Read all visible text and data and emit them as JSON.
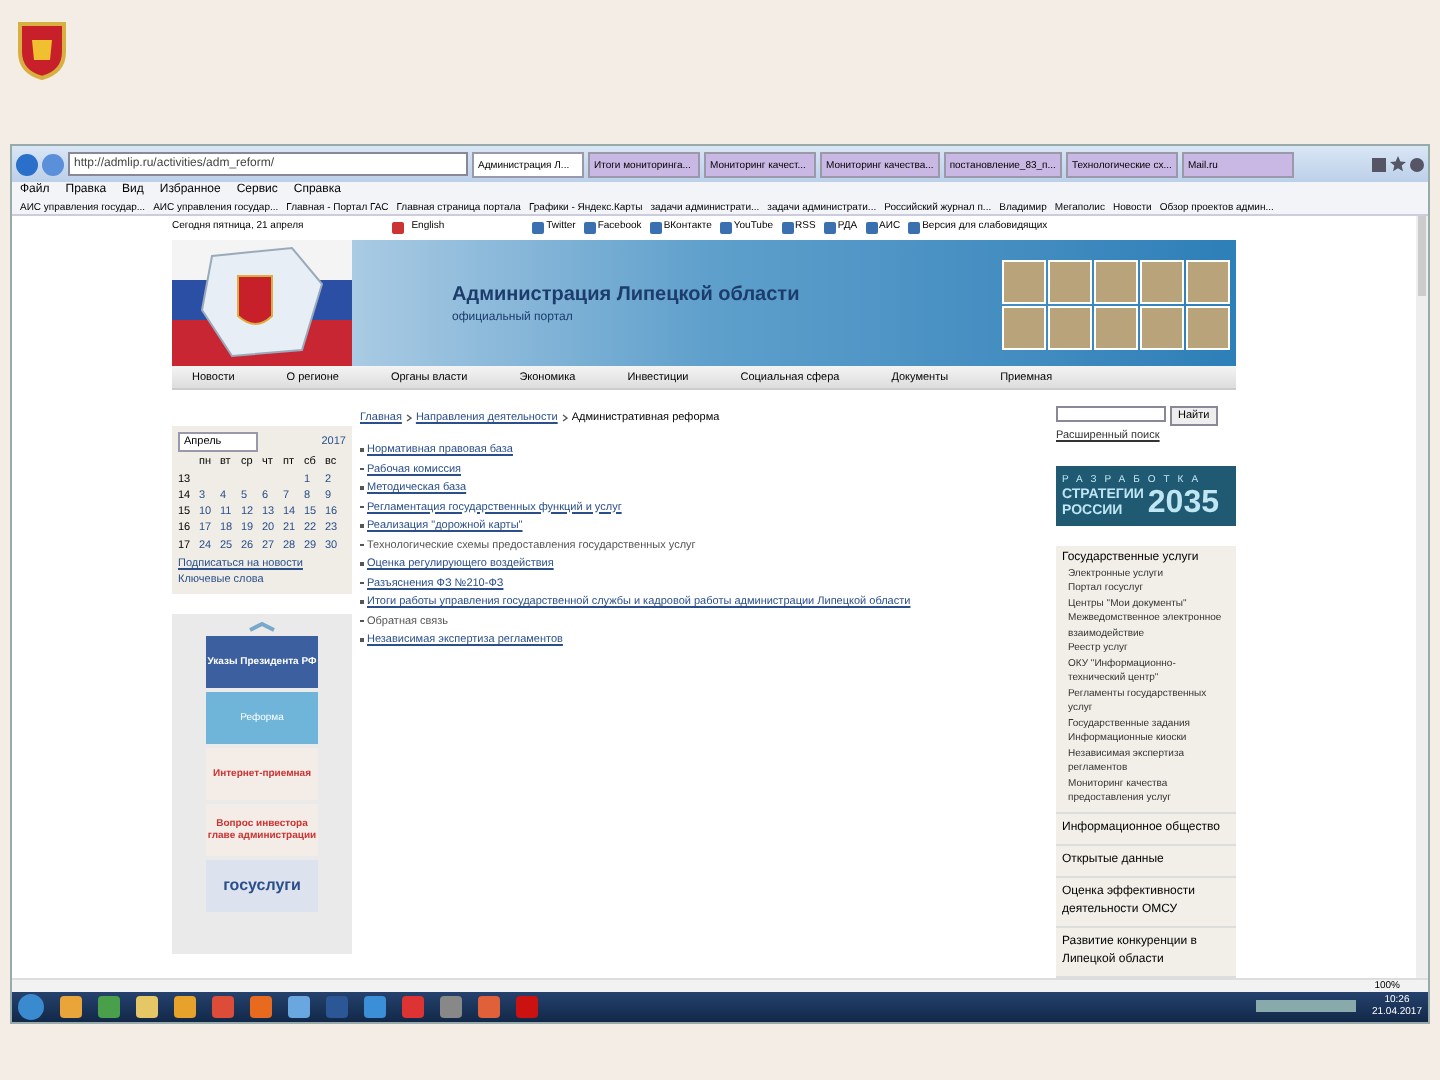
{
  "browser": {
    "address": "http://admlip.ru/activities/adm_reform/",
    "tabs": [
      {
        "title": "Администрация Л...",
        "selected": true
      },
      {
        "title": "Итоги мониторинга...",
        "selected": false
      },
      {
        "title": "Мониторинг качест...",
        "selected": false
      },
      {
        "title": "Мониторинг качества...",
        "selected": false
      },
      {
        "title": "постановление_83_п...",
        "selected": false
      },
      {
        "title": "Технологические сх...",
        "selected": false
      },
      {
        "title": "Mail.ru",
        "selected": false
      }
    ],
    "menu": [
      "Файл",
      "Правка",
      "Вид",
      "Избранное",
      "Сервис",
      "Справка"
    ],
    "favorites": [
      "АИС управления государ...",
      "АИС управления государ...",
      "Главная - Портал ГАС",
      "Главная страница портала",
      "Графики - Яндекс.Карты",
      "задачи администрати...",
      "задачи администрати...",
      "Российский журнал п...",
      "Владимир",
      "Мегаполис",
      "Новости",
      "Обзор проектов админ..."
    ],
    "zoom": "100%"
  },
  "page": {
    "topbar": {
      "date": "Сегодня пятница, 21 апреля",
      "language": "English",
      "social": [
        "Twitter",
        "Facebook",
        "ВКонтакте",
        "YouTube",
        "RSS",
        "РДА",
        "АИС",
        "Версия для слабовидящих"
      ]
    },
    "banner": {
      "title": "Администрация Липецкой области",
      "subtitle": "официальный портал"
    },
    "nav": [
      "Новости",
      "О регионе",
      "Органы власти",
      "Экономика",
      "Инвестиции",
      "Социальная сфера",
      "Документы",
      "Приемная"
    ],
    "calendar": {
      "month": "Апрель",
      "year": "2017",
      "weekdays": [
        "пн",
        "вт",
        "ср",
        "чт",
        "пт",
        "сб",
        "вс"
      ],
      "weeks": [
        {
          "number": "13",
          "days": [
            "1",
            "2"
          ]
        },
        {
          "number": "14",
          "days": [
            "3",
            "4",
            "5",
            "6",
            "7",
            "8",
            "9"
          ]
        },
        {
          "number": "15",
          "days": [
            "10",
            "11",
            "12",
            "13",
            "14",
            "15",
            "16"
          ]
        },
        {
          "number": "16",
          "days": [
            "17",
            "18",
            "19",
            "20",
            "21",
            "22",
            "23"
          ]
        },
        {
          "number": "17",
          "days": [
            "24",
            "25",
            "26",
            "27",
            "28",
            "29",
            "30"
          ]
        }
      ],
      "links": [
        "Подписаться на новости",
        "Ключевые слова"
      ]
    },
    "banners": [
      "Указы Президента РФ",
      "Реформа",
      "Интернет-приемная",
      "Вопрос инвестора главе администрации",
      "госуслуги"
    ],
    "breadcrumb": [
      "Главная",
      "Направления деятельности",
      "Административная реформа"
    ],
    "links": [
      {
        "text": "Нормативная правовая база",
        "kind": "link"
      },
      {
        "text": "Рабочая комиссия",
        "kind": "link"
      },
      {
        "text": "Методическая база",
        "kind": "link"
      },
      {
        "text": "Регламентация государственных функций и услуг",
        "kind": "link"
      },
      {
        "text": "Реализация \"дорожной карты\"",
        "kind": "link"
      },
      {
        "text": "Технологические схемы предоставления государственных услуг",
        "kind": "plain"
      },
      {
        "text": "Оценка регулирующего воздействия",
        "kind": "link"
      },
      {
        "text": "Разъяснения ФЗ №210-ФЗ",
        "kind": "link"
      },
      {
        "text": "Итоги работы управления государственной службы и кадровой работы администрации Липецкой области",
        "kind": "link"
      },
      {
        "text": "Обратная связь",
        "kind": "plain"
      },
      {
        "text": "Независимая экспертиза регламентов",
        "kind": "link"
      }
    ],
    "search": {
      "button": "Найти",
      "advanced": "Расширенный поиск"
    },
    "strategy": {
      "top": "РАЗРАБОТКА",
      "middle": "СТРАТЕГИИ",
      "bottom": "РОССИИ",
      "year": "2035"
    },
    "services": {
      "title": "Государственные услуги",
      "items": [
        "Электронные услуги",
        "Портал госуслуг",
        "Центры \"Мои документы\"",
        "Межведомственное электронное взаимодействие",
        "Реестр услуг",
        "ОКУ \"Информационно-технический центр\"",
        "Регламенты государственных услуг",
        "Государственные задания",
        "Информационные киоски",
        "Независимая экспертиза регламентов",
        "Мониторинг качества предоставления услуг"
      ]
    },
    "sections": [
      "Информационное общество",
      "Открытые данные",
      "Оценка эффективности деятельности ОМСУ",
      "Развитие конкуренции в Липецкой области"
    ]
  },
  "taskbar": {
    "time": "10:26",
    "date": "21.04.2017"
  }
}
